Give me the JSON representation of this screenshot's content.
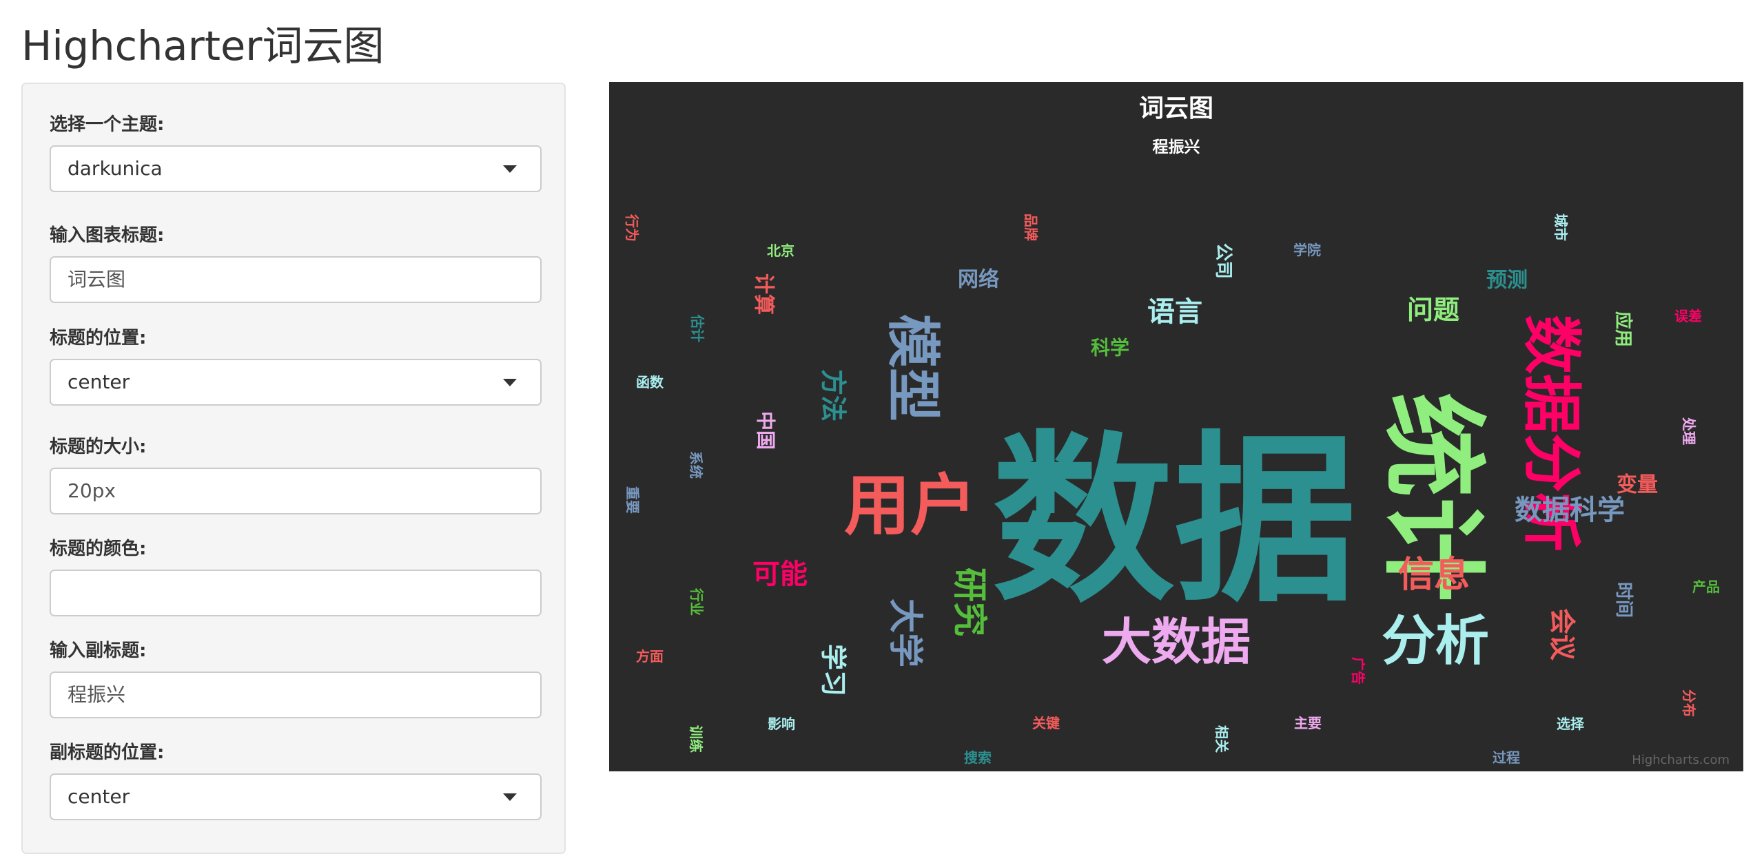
{
  "page": {
    "title": "Highcharter词云图"
  },
  "sidebar": {
    "theme": {
      "label": "选择一个主题:",
      "value": "darkunica"
    },
    "chart_title": {
      "label": "输入图表标题:",
      "value": "词云图"
    },
    "title_position": {
      "label": "标题的位置:",
      "value": "center"
    },
    "title_size": {
      "label": "标题的大小:",
      "value": "20px"
    },
    "title_color": {
      "label": "标题的颜色:",
      "value": ""
    },
    "subtitle": {
      "label": "输入副标题:",
      "value": "程振兴"
    },
    "subtitle_position": {
      "label": "副标题的位置:",
      "value": "center"
    }
  },
  "chart": {
    "credits": "Highcharts.com",
    "background": "#2a2a2b",
    "title_color": "#ffffff"
  },
  "chart_data": {
    "type": "wordcloud",
    "title": "词云图",
    "subtitle": "程振兴",
    "palette": [
      "#2b908f",
      "#90ee7e",
      "#f45b5b",
      "#7798BF",
      "#aaeeee",
      "#ff0066",
      "#eeaaee",
      "#55BF3B",
      "#DF5353"
    ],
    "words": [
      {
        "name": "数据",
        "color": "#2b908f",
        "rotated": false
      },
      {
        "name": "统计",
        "color": "#90ee7e",
        "rotated": true
      },
      {
        "name": "数据分析",
        "color": "#ff0066",
        "rotated": true
      },
      {
        "name": "用户",
        "color": "#f45b5b",
        "rotated": false
      },
      {
        "name": "模型",
        "color": "#7798BF",
        "rotated": true
      },
      {
        "name": "大数据",
        "color": "#eeaaee",
        "rotated": false
      },
      {
        "name": "分析",
        "color": "#aaeeee",
        "rotated": false
      },
      {
        "name": "信息",
        "color": "#f45b5b",
        "rotated": false
      },
      {
        "name": "数据科学",
        "color": "#7798BF",
        "rotated": false
      },
      {
        "name": "研究",
        "color": "#55BF3B",
        "rotated": true
      },
      {
        "name": "大学",
        "color": "#7798BF",
        "rotated": true
      },
      {
        "name": "语言",
        "color": "#aaeeee",
        "rotated": false
      },
      {
        "name": "可能",
        "color": "#ff0066",
        "rotated": false
      },
      {
        "name": "问题",
        "color": "#90ee7e",
        "rotated": false
      },
      {
        "name": "方法",
        "color": "#2b908f",
        "rotated": true
      },
      {
        "name": "学习",
        "color": "#aaeeee",
        "rotated": true
      },
      {
        "name": "会议",
        "color": "#f45b5b",
        "rotated": true
      },
      {
        "name": "变量",
        "color": "#f45b5b",
        "rotated": false
      },
      {
        "name": "预测",
        "color": "#2b908f",
        "rotated": false
      },
      {
        "name": "网络",
        "color": "#7798BF",
        "rotated": false
      },
      {
        "name": "计算",
        "color": "#f45b5b",
        "rotated": true
      },
      {
        "name": "科学",
        "color": "#55BF3B",
        "rotated": false
      },
      {
        "name": "中国",
        "color": "#eeaaee",
        "rotated": true
      },
      {
        "name": "应用",
        "color": "#90ee7e",
        "rotated": true
      },
      {
        "name": "公司",
        "color": "#aaeeee",
        "rotated": true
      },
      {
        "name": "时间",
        "color": "#7798BF",
        "rotated": true
      },
      {
        "name": "北京",
        "color": "#90ee7e",
        "rotated": false
      },
      {
        "name": "学院",
        "color": "#7798BF",
        "rotated": false
      },
      {
        "name": "行为",
        "color": "#f45b5b",
        "rotated": true
      },
      {
        "name": "品牌",
        "color": "#f45b5b",
        "rotated": true
      },
      {
        "name": "城市",
        "color": "#aaeeee",
        "rotated": true
      },
      {
        "name": "误差",
        "color": "#ff0066",
        "rotated": false
      },
      {
        "name": "估计",
        "color": "#2b908f",
        "rotated": true
      },
      {
        "name": "函数",
        "color": "#aaeeee",
        "rotated": false
      },
      {
        "name": "系统",
        "color": "#7798BF",
        "rotated": true
      },
      {
        "name": "重要",
        "color": "#7798BF",
        "rotated": true
      },
      {
        "name": "处理",
        "color": "#eeaaee",
        "rotated": true
      },
      {
        "name": "行业",
        "color": "#55BF3B",
        "rotated": true
      },
      {
        "name": "产品",
        "color": "#55BF3B",
        "rotated": false
      },
      {
        "name": "方面",
        "color": "#f45b5b",
        "rotated": false
      },
      {
        "name": "广告",
        "color": "#ff0066",
        "rotated": true
      },
      {
        "name": "训练",
        "color": "#90ee7e",
        "rotated": true
      },
      {
        "name": "影响",
        "color": "#aaeeee",
        "rotated": false
      },
      {
        "name": "关键",
        "color": "#f45b5b",
        "rotated": false
      },
      {
        "name": "相关",
        "color": "#aaeeee",
        "rotated": true
      },
      {
        "name": "主要",
        "color": "#eeaaee",
        "rotated": false
      },
      {
        "name": "选择",
        "color": "#aaeeee",
        "rotated": false
      },
      {
        "name": "分布",
        "color": "#f45b5b",
        "rotated": true
      },
      {
        "name": "搜索",
        "color": "#2b908f",
        "rotated": false
      },
      {
        "name": "过程",
        "color": "#7798BF",
        "rotated": false
      }
    ]
  }
}
